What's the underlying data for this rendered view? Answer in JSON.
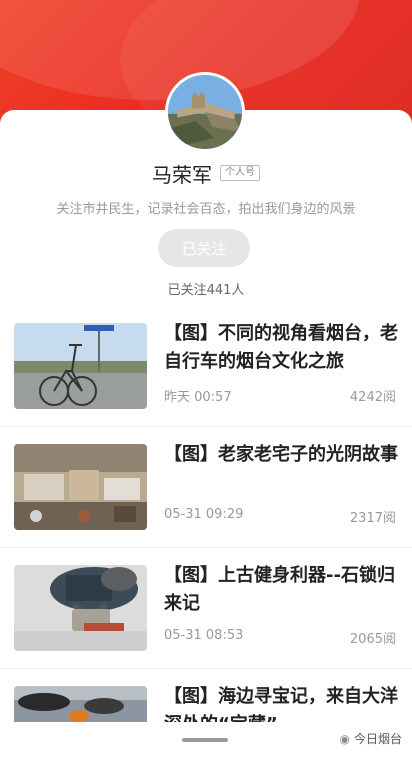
{
  "profile": {
    "name": "马荣军",
    "tag": "个人号",
    "bio": "关注市井民生，记录社会百态，拍出我们身边的风景",
    "follow_button": "已关注",
    "followers": "已关注441人"
  },
  "articles": [
    {
      "title": "【图】不同的视角看烟台，老自行车的烟台文化之旅",
      "time": "昨天 00:57",
      "reads": "4242阅"
    },
    {
      "title": "【图】老家老宅子的光阴故事",
      "time": "05-31 09:29",
      "reads": "2317阅"
    },
    {
      "title": "【图】上古健身利器--石锁归来记",
      "time": "05-31 08:53",
      "reads": "2065阅"
    },
    {
      "title": "【图】海边寻宝记，来自大洋深处的“宝藏”",
      "time": "",
      "reads": ""
    }
  ],
  "watermark": {
    "brand": "今日烟台"
  },
  "colors": {
    "header_red": "#e8281e",
    "follow_button_bg": "#e6e6e6"
  }
}
